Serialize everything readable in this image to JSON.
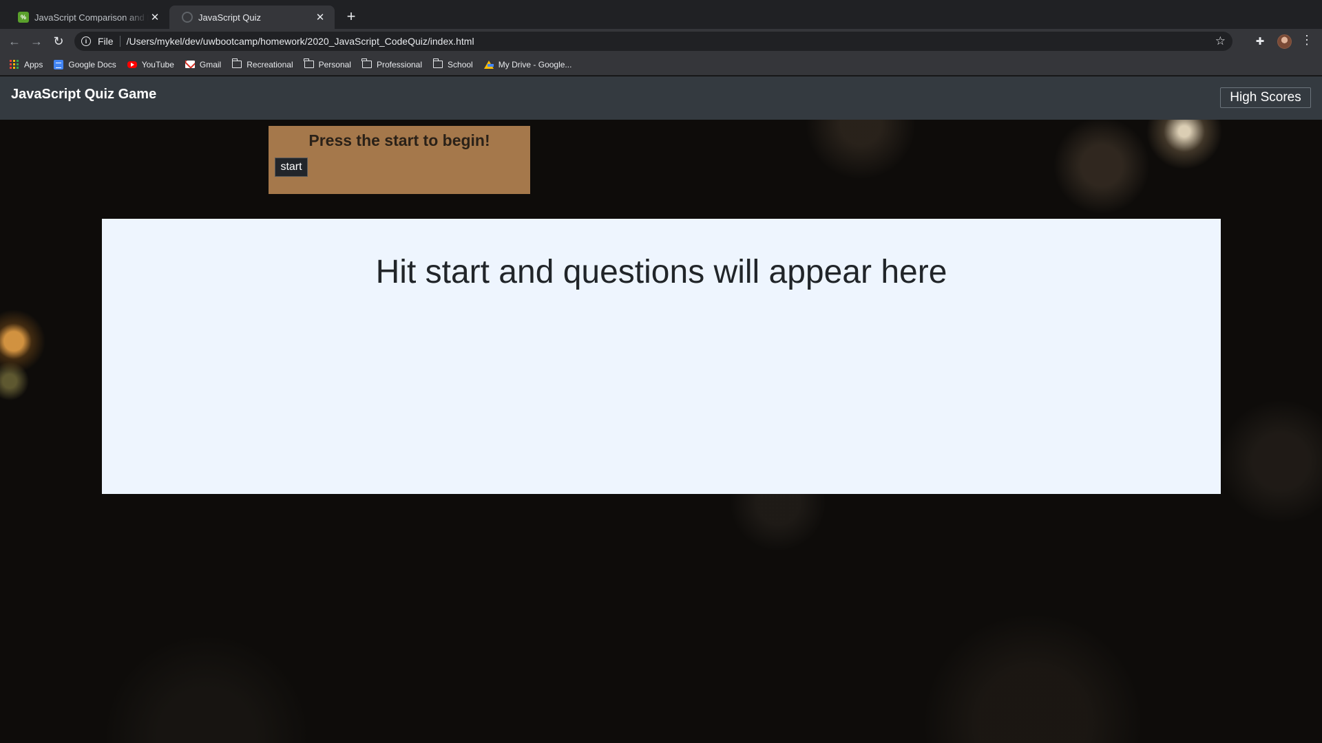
{
  "browser": {
    "tabs": [
      {
        "title": "JavaScript Comparison and Logical Operators",
        "favicon": "calculator-favicon",
        "active": false
      },
      {
        "title": "JavaScript Quiz",
        "favicon": "globe-favicon",
        "active": true
      }
    ],
    "close_glyph": "✕",
    "new_tab_glyph": "+",
    "address": {
      "scheme_label": "File",
      "url": "/Users/mykel/dev/uwbootcamp/homework/2020_JavaScript_CodeQuiz/index.html"
    },
    "bookmarks": [
      {
        "label": "Apps",
        "icon": "apps-grid-icon"
      },
      {
        "label": "Google Docs",
        "icon": "google-docs-icon"
      },
      {
        "label": "YouTube",
        "icon": "youtube-icon"
      },
      {
        "label": "Gmail",
        "icon": "gmail-icon"
      },
      {
        "label": "Recreational",
        "icon": "folder-icon"
      },
      {
        "label": "Personal",
        "icon": "folder-icon"
      },
      {
        "label": "Professional",
        "icon": "folder-icon"
      },
      {
        "label": "School",
        "icon": "folder-icon"
      },
      {
        "label": "My Drive - Google...",
        "icon": "google-drive-icon"
      }
    ]
  },
  "page": {
    "brand": "JavaScript Quiz Game",
    "high_scores_label": "High Scores",
    "start_prompt": "Press the start to begin!",
    "start_button_label": "start",
    "question_placeholder": "Hit start and questions will appear here"
  },
  "colors": {
    "navbar": "#343a40",
    "start_card": "#a5784b",
    "quiz_box": "#eef5fe",
    "page_background": "#0e0c0a"
  }
}
